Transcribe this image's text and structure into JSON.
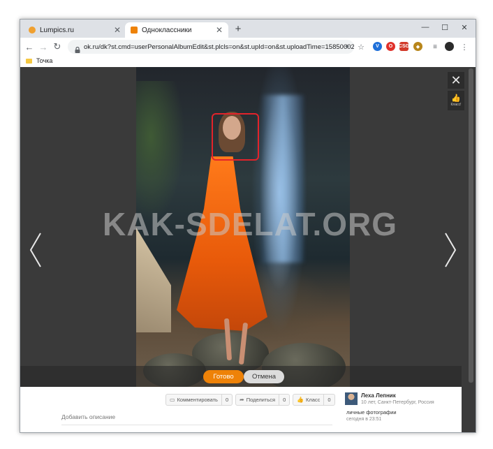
{
  "tabs": [
    {
      "title": "Lumpics.ru",
      "active": false,
      "favicon_color": "#f0a030"
    },
    {
      "title": "Одноклассники",
      "active": true,
      "favicon_color": "#ee8208"
    }
  ],
  "window_controls": {
    "minimize": "—",
    "maximize": "☐",
    "close": "✕"
  },
  "toolbar": {
    "back": "←",
    "forward": "→",
    "reload": "↻",
    "url": "ok.ru/dk?st.cmd=userPersonalAlbumEdit&st.plcls=on&st.upId=on&st.uploadTime=158500027..."
  },
  "bookmarks": [
    {
      "label": "Точка"
    }
  ],
  "viewer": {
    "watermark": "KAK-SDELAT.ORG",
    "close_symbol": "✕",
    "klass_label": "Класс!",
    "done_label": "Готово",
    "cancel_label": "Отмена"
  },
  "actions": [
    {
      "label": "Комментировать",
      "count": "0",
      "icon": "comment-icon",
      "glyph": "▭"
    },
    {
      "label": "Поделиться",
      "count": "0",
      "icon": "share-icon",
      "glyph": "➦"
    },
    {
      "label": "Класс",
      "count": "0",
      "icon": "thumb-up-icon",
      "glyph": "👍"
    }
  ],
  "description_placeholder": "Добавить описание",
  "user": {
    "name": "Леха Лепник",
    "meta": "10 лет, Санкт-Петербург, Россия",
    "album": "личные фотографии",
    "timestamp": "сегодня в 23:51"
  },
  "colors": {
    "accent": "#ee8208",
    "highlight": "#e3232a"
  }
}
